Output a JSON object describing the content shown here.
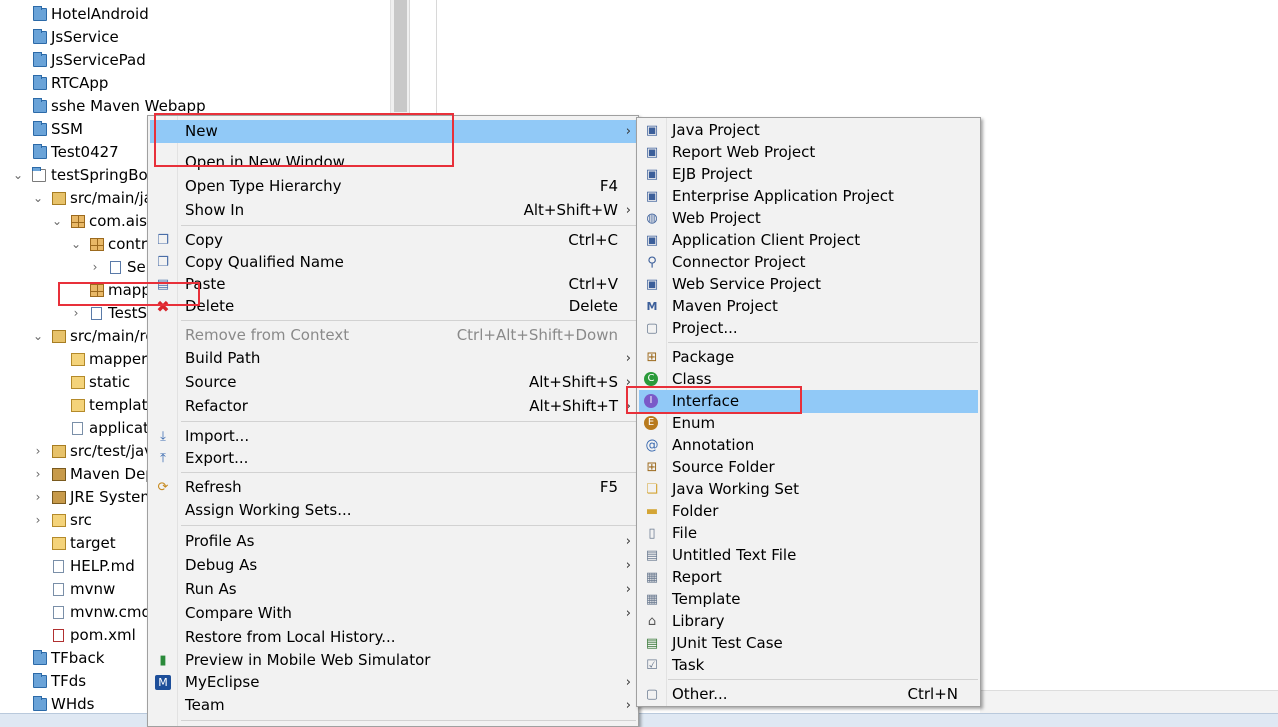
{
  "tree": {
    "items": [
      {
        "label": "HotelAndroid",
        "icon": "project-folder-icon"
      },
      {
        "label": "JsService",
        "icon": "project-folder-icon"
      },
      {
        "label": "JsServicePad",
        "icon": "project-folder-icon"
      },
      {
        "label": "RTCApp",
        "icon": "project-folder-icon"
      },
      {
        "label": "sshe Maven Webapp",
        "icon": "project-folder-icon"
      },
      {
        "label": "SSM",
        "icon": "project-folder-icon"
      },
      {
        "label": "Test0427",
        "icon": "project-folder-icon"
      },
      {
        "label": "testSpringBo",
        "icon": "maven-project-icon"
      },
      {
        "label": "src/main/ja",
        "icon": "source-folder-icon"
      },
      {
        "label": "com.aisi",
        "icon": "package-icon"
      },
      {
        "label": "contr",
        "icon": "package-icon"
      },
      {
        "label": "Se",
        "icon": "java-file-icon"
      },
      {
        "label": "mapp",
        "icon": "package-icon"
      },
      {
        "label": "TestS",
        "icon": "java-file-icon"
      },
      {
        "label": "src/main/re",
        "icon": "source-folder-icon"
      },
      {
        "label": "mapper",
        "icon": "folder-icon"
      },
      {
        "label": "static",
        "icon": "folder-icon"
      },
      {
        "label": "templat",
        "icon": "folder-icon"
      },
      {
        "label": "applicat",
        "icon": "file-icon"
      },
      {
        "label": "src/test/jav",
        "icon": "source-folder-icon"
      },
      {
        "label": "Maven Dep",
        "icon": "library-icon"
      },
      {
        "label": "JRE System",
        "icon": "library-icon"
      },
      {
        "label": "src",
        "icon": "folder-icon"
      },
      {
        "label": "target",
        "icon": "folder-icon"
      },
      {
        "label": "HELP.md",
        "icon": "file-icon"
      },
      {
        "label": "mvnw",
        "icon": "file-icon"
      },
      {
        "label": "mvnw.cmd",
        "icon": "file-icon"
      },
      {
        "label": "pom.xml",
        "icon": "xml-file-icon"
      },
      {
        "label": "TFback",
        "icon": "project-folder-icon"
      },
      {
        "label": "TFds",
        "icon": "project-folder-icon"
      },
      {
        "label": "WHds",
        "icon": "project-folder-icon"
      }
    ]
  },
  "context_menu": {
    "items": [
      {
        "label": "New",
        "key": "",
        "submenu": true,
        "highlighted": true
      },
      {
        "label": "Open in New Window",
        "key": "",
        "submenu": false
      },
      {
        "label": "Open Type Hierarchy",
        "key": "F4",
        "submenu": false
      },
      {
        "label": "Show In",
        "key": "Alt+Shift+W",
        "submenu": true
      },
      {
        "label": "Copy",
        "key": "Ctrl+C",
        "submenu": false,
        "icon": "copy-icon"
      },
      {
        "label": "Copy Qualified Name",
        "key": "",
        "submenu": false,
        "icon": "copy-qualified-icon"
      },
      {
        "label": "Paste",
        "key": "Ctrl+V",
        "submenu": false,
        "icon": "paste-icon"
      },
      {
        "label": "Delete",
        "key": "Delete",
        "submenu": false,
        "icon": "delete-icon"
      },
      {
        "label": "Remove from Context",
        "key": "Ctrl+Alt+Shift+Down",
        "submenu": false,
        "disabled": true
      },
      {
        "label": "Build Path",
        "key": "",
        "submenu": true
      },
      {
        "label": "Source",
        "key": "Alt+Shift+S",
        "submenu": true
      },
      {
        "label": "Refactor",
        "key": "Alt+Shift+T",
        "submenu": true
      },
      {
        "label": "Import...",
        "key": "",
        "submenu": false,
        "icon": "import-icon"
      },
      {
        "label": "Export...",
        "key": "",
        "submenu": false,
        "icon": "export-icon"
      },
      {
        "label": "Refresh",
        "key": "F5",
        "submenu": false,
        "icon": "refresh-icon"
      },
      {
        "label": "Assign Working Sets...",
        "key": "",
        "submenu": false
      },
      {
        "label": "Profile As",
        "key": "",
        "submenu": true
      },
      {
        "label": "Debug As",
        "key": "",
        "submenu": true
      },
      {
        "label": "Run As",
        "key": "",
        "submenu": true
      },
      {
        "label": "Compare With",
        "key": "",
        "submenu": true
      },
      {
        "label": "Restore from Local History...",
        "key": "",
        "submenu": false
      },
      {
        "label": "Preview in Mobile Web Simulator",
        "key": "",
        "submenu": false,
        "icon": "mobile-simulator-icon"
      },
      {
        "label": "MyEclipse",
        "key": "",
        "submenu": true,
        "icon": "myeclipse-icon"
      },
      {
        "label": "Team",
        "key": "",
        "submenu": true
      }
    ]
  },
  "new_submenu": {
    "items": [
      {
        "label": "Java Project",
        "key": "",
        "icon": "java-project-icon"
      },
      {
        "label": "Report Web Project",
        "key": "",
        "icon": "report-web-project-icon"
      },
      {
        "label": "EJB Project",
        "key": "",
        "icon": "ejb-project-icon"
      },
      {
        "label": "Enterprise Application Project",
        "key": "",
        "icon": "enterprise-project-icon"
      },
      {
        "label": "Web Project",
        "key": "",
        "icon": "web-project-icon"
      },
      {
        "label": "Application Client Project",
        "key": "",
        "icon": "app-client-project-icon"
      },
      {
        "label": "Connector Project",
        "key": "",
        "icon": "connector-project-icon"
      },
      {
        "label": "Web Service Project",
        "key": "",
        "icon": "web-service-project-icon"
      },
      {
        "label": "Maven Project",
        "key": "",
        "icon": "maven-project-icon"
      },
      {
        "label": "Project...",
        "key": "",
        "icon": "project-icon"
      },
      {
        "label": "Package",
        "key": "",
        "icon": "package-icon"
      },
      {
        "label": "Class",
        "key": "",
        "icon": "class-icon"
      },
      {
        "label": "Interface",
        "key": "",
        "icon": "interface-icon",
        "highlighted": true
      },
      {
        "label": "Enum",
        "key": "",
        "icon": "enum-icon"
      },
      {
        "label": "Annotation",
        "key": "",
        "icon": "annotation-icon"
      },
      {
        "label": "Source Folder",
        "key": "",
        "icon": "source-folder-icon"
      },
      {
        "label": "Java Working Set",
        "key": "",
        "icon": "working-set-icon"
      },
      {
        "label": "Folder",
        "key": "",
        "icon": "folder-icon"
      },
      {
        "label": "File",
        "key": "",
        "icon": "file-icon"
      },
      {
        "label": "Untitled Text File",
        "key": "",
        "icon": "text-file-icon"
      },
      {
        "label": "Report",
        "key": "",
        "icon": "report-icon"
      },
      {
        "label": "Template",
        "key": "",
        "icon": "template-icon"
      },
      {
        "label": "Library",
        "key": "",
        "icon": "library-icon"
      },
      {
        "label": "JUnit Test Case",
        "key": "",
        "icon": "junit-test-icon"
      },
      {
        "label": "Task",
        "key": "",
        "icon": "task-icon"
      },
      {
        "label": "Other...",
        "key": "Ctrl+N",
        "icon": "other-wizard-icon"
      }
    ]
  },
  "colors": {
    "highlight": "#91c9f7",
    "annotation_red": "#e8303a",
    "menu_bg": "#f2f2f2"
  }
}
